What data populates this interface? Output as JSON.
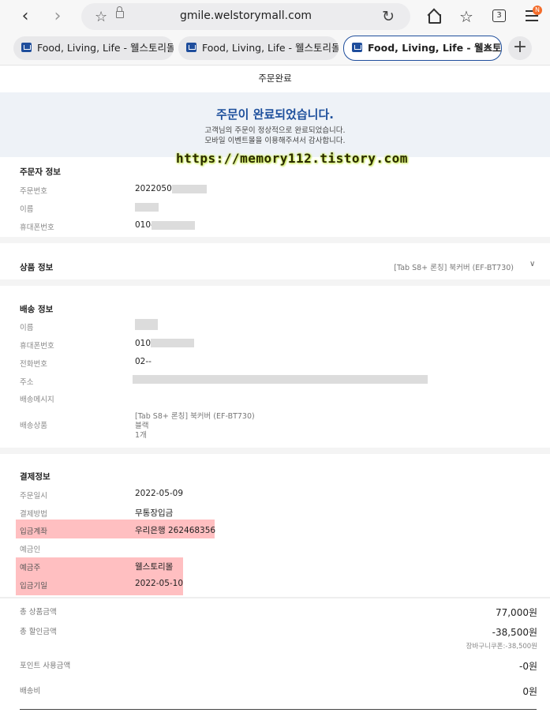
{
  "browser": {
    "url": "gmile.welstorymall.com",
    "tab_count": "3",
    "badge": "N",
    "tabs": [
      {
        "title": "Food, Living, Life - 웰스토리몰"
      },
      {
        "title": "Food, Living, Life - 웰스토리몰"
      },
      {
        "title": "Food, Living, Life - 웰스토..."
      }
    ]
  },
  "page": {
    "title": "주문완료",
    "banner_heading": "주문이 완료되었습니다.",
    "banner_line1": "고객님의 주문이 정상적으로 완료되었습니다.",
    "banner_line2": "모바일 이벤트몰을 이용해주셔서 감사합니다.",
    "watermark": "https://memory112.tistory.com"
  },
  "orderer": {
    "section_title": "주문자 정보",
    "order_no_label": "주문번호",
    "order_no_value": "20220509",
    "name_label": "이름",
    "phone_label": "휴대폰번호",
    "phone_value": "010-"
  },
  "product": {
    "section_title": "상품 정보",
    "summary": "[Tab S8+ 론칭] 북커버 (EF-BT730)"
  },
  "shipping": {
    "section_title": "배송 정보",
    "name_label": "이름",
    "phone_label": "휴대폰번호",
    "phone_value": "010-",
    "tel_label": "전화번호",
    "tel_value": "02--",
    "address_label": "주소",
    "message_label": "배송메시지",
    "items_label": "배송상품",
    "item_name": "[Tab S8+ 론칭] 북커버 (EF-BT730)",
    "item_option": "블랙",
    "item_qty": "1개"
  },
  "payment": {
    "section_title": "결제정보",
    "date_label": "주문일시",
    "date_value": "2022-05-09",
    "method_label": "결제방법",
    "method_value": "무통장입금",
    "account_label": "입금계좌",
    "account_value": "우리은행 262468356",
    "depositor_label": "예금인",
    "holder_label": "예금주",
    "holder_value": "웰스토리몰",
    "deadline_label": "입금기일",
    "deadline_value": "2022-05-10"
  },
  "summary": {
    "total_label": "총 상품금액",
    "total_value": "77,000원",
    "discount_label": "총 할인금액",
    "discount_value": "-38,500원",
    "discount_detail": "장바구니쿠폰:-38,500원",
    "point_label": "포인트 사용금액",
    "point_value": "-0원",
    "shipping_label": "배송비",
    "shipping_value": "0원"
  },
  "colors": {
    "accent": "#1d4f9c",
    "highlight": "#ffbfc1",
    "banner_bg": "#eef2f7"
  }
}
